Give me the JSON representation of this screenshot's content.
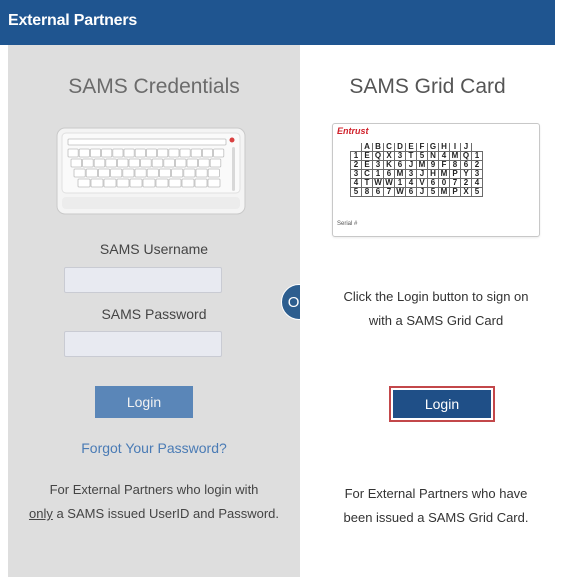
{
  "header": {
    "title": "External Partners"
  },
  "left": {
    "title": "SAMS Credentials",
    "username_label": "SAMS Username",
    "password_label": "SAMS Password",
    "login_label": "Login",
    "forgot_label": "Forgot Your Password?",
    "description_part1": "For External Partners who login with",
    "description_underlined": "only",
    "description_part2": "a SAMS issued UserID and Password."
  },
  "divider": {
    "or_label": "OR"
  },
  "right": {
    "title": "SAMS Grid Card",
    "card": {
      "brand": "Entrust",
      "columns": [
        "A",
        "B",
        "C",
        "D",
        "E",
        "F",
        "G",
        "H",
        "I",
        "J"
      ],
      "rows": [
        {
          "num": "1",
          "cells": [
            "E",
            "Q",
            "X",
            "3",
            "T",
            "5",
            "N",
            "4",
            "M",
            "Q"
          ]
        },
        {
          "num": "2",
          "cells": [
            "E",
            "3",
            "K",
            "6",
            "J",
            "M",
            "9",
            "F",
            "8",
            "6"
          ]
        },
        {
          "num": "3",
          "cells": [
            "C",
            "1",
            "6",
            "M",
            "3",
            "J",
            "H",
            "M",
            "P",
            "Y"
          ]
        },
        {
          "num": "4",
          "cells": [
            "T",
            "W",
            "W",
            "1",
            "4",
            "V",
            "6",
            "0",
            "7",
            "2"
          ]
        },
        {
          "num": "5",
          "cells": [
            "8",
            "6",
            "7",
            "W",
            "6",
            "J",
            "5",
            "M",
            "P",
            "X"
          ]
        }
      ],
      "serial_label": "Serial #"
    },
    "instruction": "Click the Login button to sign on with a SAMS Grid Card",
    "login_label": "Login",
    "description": "For External Partners who have been issued a SAMS Grid Card."
  },
  "colors": {
    "header_bg": "#1f5590",
    "left_panel_bg": "#dedede",
    "left_login_bg": "#5a86b8",
    "right_login_bg": "#1f4f87",
    "focus_outline": "#c3474a",
    "link": "#4a7bb5"
  }
}
